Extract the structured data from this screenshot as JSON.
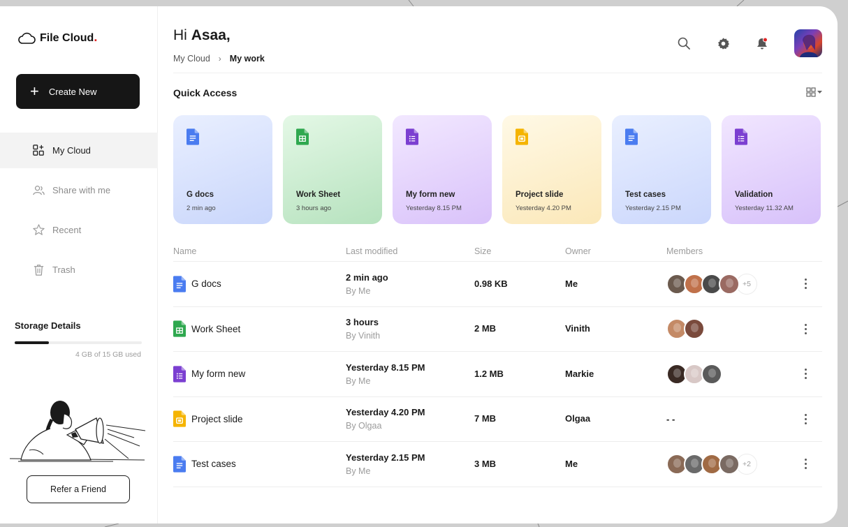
{
  "brand": {
    "name": "File Cloud",
    "dot": ".",
    "accent": "#e02424"
  },
  "sidebar": {
    "create_label": "Create New",
    "items": [
      {
        "label": "My Cloud",
        "icon": "grid-apps-icon",
        "active": true
      },
      {
        "label": "Share with me",
        "icon": "users-icon",
        "active": false
      },
      {
        "label": "Recent",
        "icon": "star-icon",
        "active": false
      },
      {
        "label": "Trash",
        "icon": "trash-icon",
        "active": false
      }
    ],
    "storage": {
      "title": "Storage Details",
      "used_text": "4 GB of 15 GB used",
      "used_fraction": 0.27
    },
    "refer_label": "Refer a Friend"
  },
  "header": {
    "greeting_prefix": "Hi",
    "greeting_name": "Asaa,",
    "breadcrumb": {
      "root": "My Cloud",
      "separator": "›",
      "current": "My work"
    }
  },
  "quick_access": {
    "title": "Quick Access",
    "cards": [
      {
        "name": "G docs",
        "time": "2 min ago",
        "type": "doc"
      },
      {
        "name": "Work Sheet",
        "time": "3 hours ago",
        "type": "sheet"
      },
      {
        "name": "My form new",
        "time": "Yesterday 8.15 PM",
        "type": "form"
      },
      {
        "name": "Project slide",
        "time": "Yesterday 4.20 PM",
        "type": "slide"
      },
      {
        "name": "Test cases",
        "time": "Yesterday 2.15 PM",
        "type": "doc"
      },
      {
        "name": "Validation",
        "time": "Yesterday 11.32 AM",
        "type": "form"
      }
    ]
  },
  "table": {
    "headers": [
      "Name",
      "Last modified",
      "Size",
      "Owner",
      "Members"
    ],
    "rows": [
      {
        "name": "G docs",
        "type": "doc",
        "modified": "2 min ago",
        "by": "By Me",
        "size": "0.98 KB",
        "owner": "Me",
        "member_count": 4,
        "more": "+5"
      },
      {
        "name": "Work Sheet",
        "type": "sheet",
        "modified": "3 hours",
        "by": "By Vinith",
        "size": "2 MB",
        "owner": "Vinith",
        "member_count": 2,
        "more": ""
      },
      {
        "name": "My form new",
        "type": "form",
        "modified": "Yesterday 8.15 PM",
        "by": "By Me",
        "size": "1.2 MB",
        "owner": "Markie",
        "member_count": 3,
        "more": ""
      },
      {
        "name": "Project slide",
        "type": "slide",
        "modified": "Yesterday 4.20 PM",
        "by": "By Olgaa",
        "size": "7 MB",
        "owner": "Olgaa",
        "member_count": 0,
        "more": "",
        "none_text": "- -"
      },
      {
        "name": "Test cases",
        "type": "doc",
        "modified": "Yesterday 2.15 PM",
        "by": "By Me",
        "size": "3 MB",
        "owner": "Me",
        "member_count": 4,
        "more": "+2"
      }
    ]
  },
  "colors": {
    "doc": "#4a7cf0",
    "sheet": "#2fa84f",
    "form": "#7b3fd1",
    "slide": "#f5b400"
  }
}
